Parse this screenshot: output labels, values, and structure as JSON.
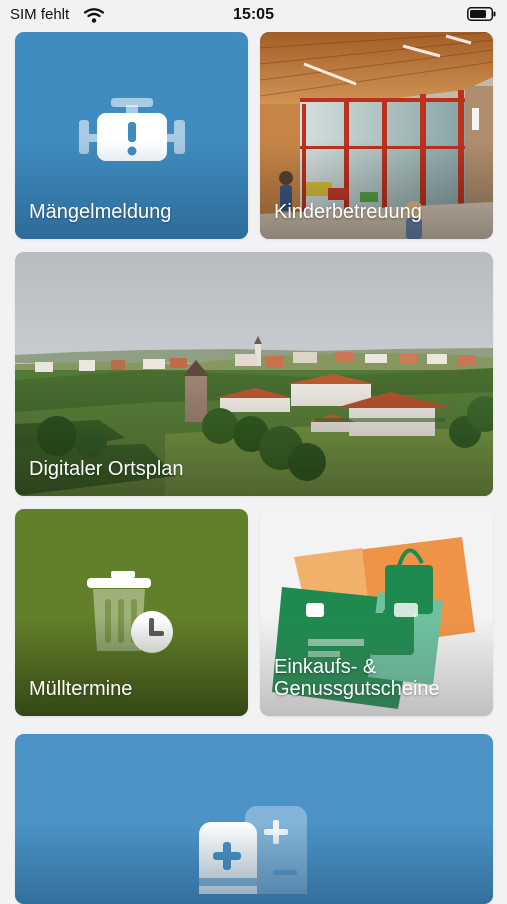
{
  "status_bar": {
    "carrier": "SIM fehlt",
    "time": "15:05",
    "wifi_icon": "wifi-icon",
    "battery_icon": "battery-icon"
  },
  "tiles": [
    {
      "label": "Mängelmeldung",
      "icon": "engine-warning-icon",
      "color": "#3f8cc0"
    },
    {
      "label": "Kinderbetreuung",
      "icon": "kindergarten-photo"
    },
    {
      "label": "Digitaler Ortsplan",
      "icon": "village-landscape-photo"
    },
    {
      "label": "Mülltermine",
      "icon": "trash-can-clock-icon",
      "color": "#62802a"
    },
    {
      "label": "Einkaufs- & Genussgutscheine",
      "icon": "voucher-bags-photo"
    },
    {
      "label": "",
      "icon": "health-cards-icon",
      "color": "#4b93c6"
    }
  ],
  "colors": {
    "background": "#f2f2f4",
    "text_on_tile": "#ffffff"
  }
}
